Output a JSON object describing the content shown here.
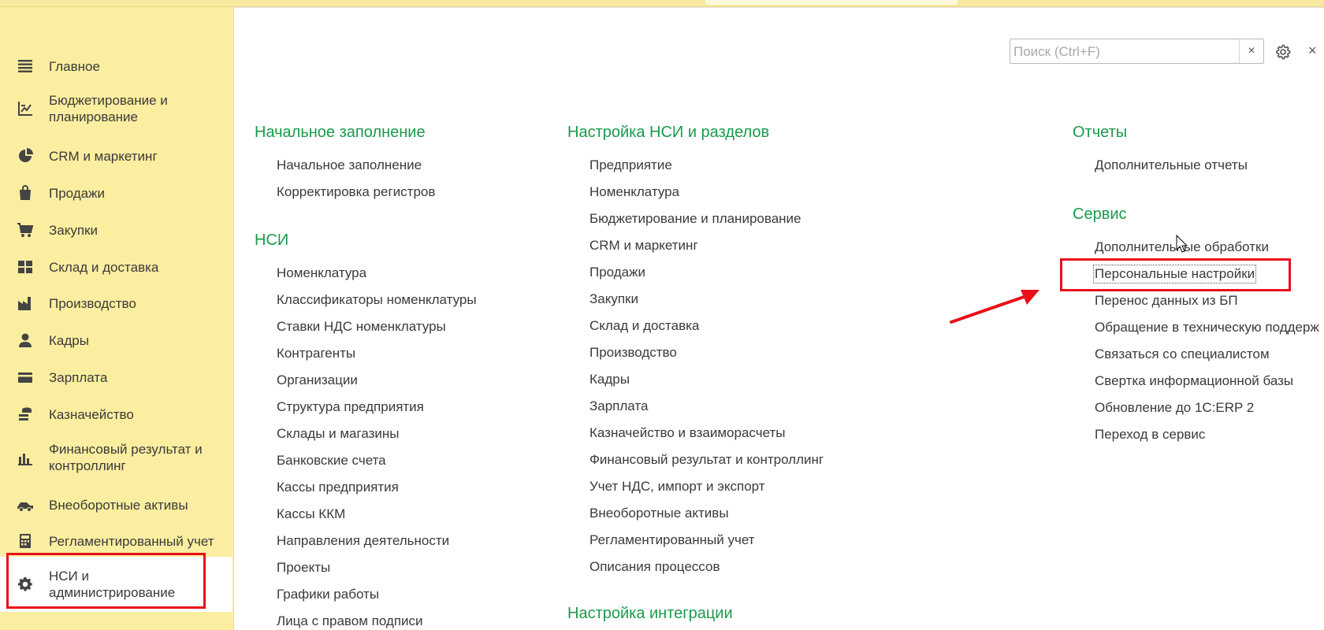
{
  "sidebar": {
    "items": [
      {
        "label": "Главное",
        "icon": "menu-lines-icon"
      },
      {
        "label": "Бюджетирование и\nпланирование",
        "icon": "chart-axes-icon"
      },
      {
        "label": "CRM и маркетинг",
        "icon": "pie-chart-icon"
      },
      {
        "label": "Продажи",
        "icon": "shopping-bag-icon"
      },
      {
        "label": "Закупки",
        "icon": "cart-icon"
      },
      {
        "label": "Склад и доставка",
        "icon": "warehouse-grid-icon"
      },
      {
        "label": "Производство",
        "icon": "factory-icon"
      },
      {
        "label": "Кадры",
        "icon": "person-icon"
      },
      {
        "label": "Зарплата",
        "icon": "wallet-card-icon"
      },
      {
        "label": "Казначейство",
        "icon": "coins-icon"
      },
      {
        "label": "Финансовый результат и\nконтроллинг",
        "icon": "bar-chart-icon"
      },
      {
        "label": "Внеоборотные активы",
        "icon": "truck-icon"
      },
      {
        "label": "Регламентированный учет",
        "icon": "calculator-icon"
      },
      {
        "label": "НСИ и\nадминистрирование",
        "icon": "gear-icon",
        "active": true
      }
    ]
  },
  "search": {
    "placeholder": "Поиск (Ctrl+F)",
    "value": "",
    "clear_label": "×"
  },
  "header": {
    "close_label": "×"
  },
  "columns": {
    "col1": {
      "groups": [
        {
          "title": "Начальное заполнение",
          "items": [
            "Начальное заполнение",
            "Корректировка регистров"
          ]
        },
        {
          "title": "НСИ",
          "items": [
            "Номенклатура",
            "Классификаторы номенклатуры",
            "Ставки НДС номенклатуры",
            "Контрагенты",
            "Организации",
            "Структура предприятия",
            "Склады и магазины",
            "Банковские счета",
            "Кассы предприятия",
            "Кассы ККМ",
            "Направления деятельности",
            "Проекты",
            "Графики работы",
            "Лица с правом подписи"
          ]
        }
      ]
    },
    "col2": {
      "groups": [
        {
          "title": "Настройка НСИ и разделов",
          "items": [
            "Предприятие",
            "Номенклатура",
            "Бюджетирование и планирование",
            "CRM и маркетинг",
            "Продажи",
            "Закупки",
            "Склад и доставка",
            "Производство",
            "Кадры",
            "Зарплата",
            "Казначейство и взаиморасчеты",
            "Финансовый результат и контроллинг",
            "Учет НДС, импорт и экспорт",
            "Внеоборотные активы",
            "Регламентированный учет",
            "Описания процессов"
          ]
        },
        {
          "title": "Настройка интеграции",
          "items": []
        }
      ]
    },
    "col3": {
      "groups": [
        {
          "title": "Отчеты",
          "items": [
            "Дополнительные отчеты"
          ]
        },
        {
          "title": "Сервис",
          "items": [
            "Дополнительные обработки",
            "Персональные настройки",
            "Перенос данных из БП",
            "Обращение в техническую поддерж",
            "Связаться со специалистом",
            "Свертка информационной базы",
            "Обновление до 1С:ERP 2",
            "Переход в сервис"
          ]
        }
      ]
    }
  },
  "colors": {
    "accent_green": "#1a9a4b",
    "highlight_red": "#e8101a",
    "sidebar_bg": "#fbeea0"
  }
}
